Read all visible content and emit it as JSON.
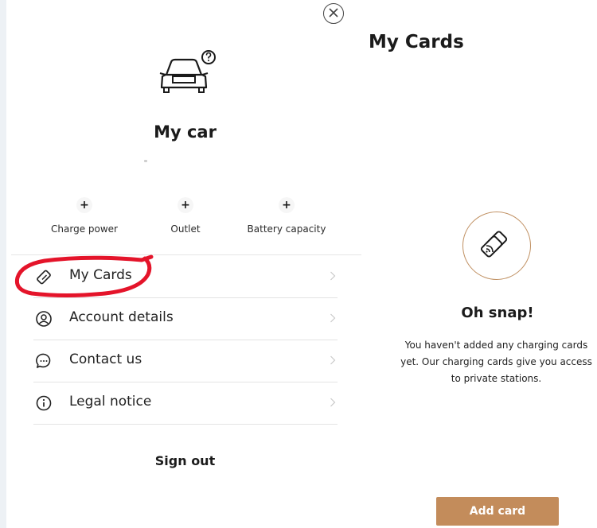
{
  "profile": {
    "title": "My car",
    "stats": [
      {
        "icon": "plus-icon",
        "label": "Charge power"
      },
      {
        "icon": "plus-icon",
        "label": "Outlet"
      },
      {
        "icon": "plus-icon",
        "label": "Battery capacity"
      }
    ]
  },
  "menu": {
    "items": [
      {
        "icon": "card-icon",
        "label": "My Cards",
        "highlighted": true
      },
      {
        "icon": "user-icon",
        "label": "Account details"
      },
      {
        "icon": "chat-icon",
        "label": "Contact us"
      },
      {
        "icon": "info-icon",
        "label": "Legal notice"
      }
    ],
    "sign_out": "Sign out"
  },
  "cards_page": {
    "title": "My Cards",
    "empty_title": "Oh snap!",
    "empty_lines": [
      "You haven't added any charging cards",
      "yet. Our charging cards give you access",
      "to private stations."
    ],
    "add_button": "Add card"
  },
  "colors": {
    "accent": "#c38c5b",
    "annotation": "#e4142a",
    "divider": "#e3e3e3"
  }
}
